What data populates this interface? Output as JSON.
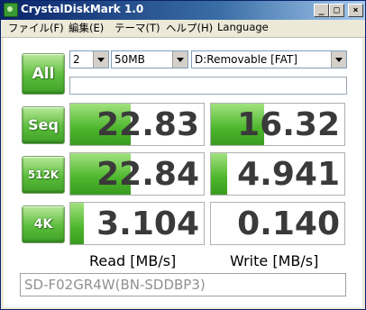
{
  "window": {
    "title": "CrystalDiskMark 1.0",
    "buttons": {
      "minimize": "_",
      "maximize": "□",
      "close": "×"
    }
  },
  "menu": [
    "ファイル(F)",
    "編集(E)",
    "テーマ(T)",
    "ヘルプ(H)",
    "Language"
  ],
  "controls": {
    "all_label": "All",
    "runs": "2",
    "size": "50MB",
    "drive": "D:Removable [FAT]"
  },
  "tests": [
    {
      "label": "Seq",
      "read": "22.83",
      "write": "16.32",
      "read_fill": 0.45,
      "write_fill": 0.4
    },
    {
      "label": "512K",
      "read": "22.84",
      "write": "4.941",
      "read_fill": 0.45,
      "write_fill": 0.12
    },
    {
      "label": "4K",
      "read": "3.104",
      "write": "0.140",
      "read_fill": 0.1,
      "write_fill": 0.0
    }
  ],
  "columns": {
    "read": "Read [MB/s]",
    "write": "Write [MB/s]"
  },
  "comment": "SD-F02GR4W(BN-SDDBP3)",
  "colors": {
    "accent_green": "#4cb62c",
    "titlebar": "#0a246a"
  }
}
